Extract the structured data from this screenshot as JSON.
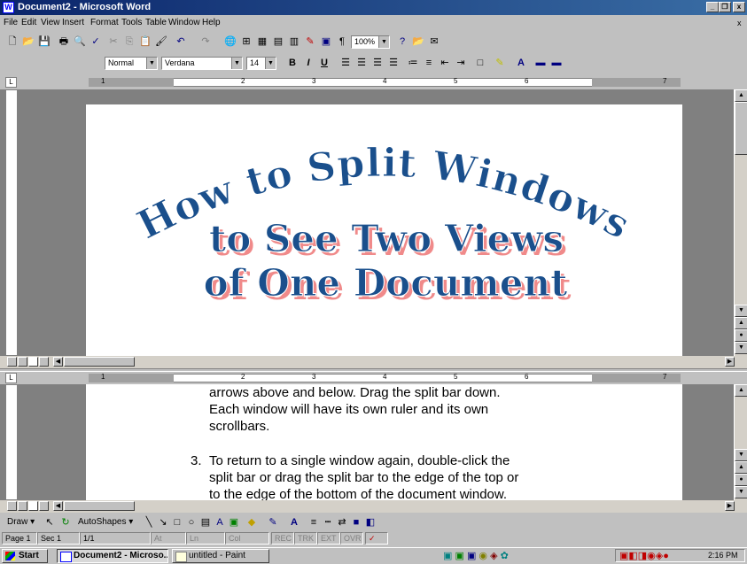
{
  "window": {
    "title": "Document2 - Microsoft Word",
    "minimize_label": "_",
    "restore_label": "❐",
    "close_label": "x"
  },
  "menu": [
    "File",
    "Edit",
    "View",
    "Insert",
    "Format",
    "Tools",
    "Table",
    "Window",
    "Help"
  ],
  "toolbar": {
    "zoom": "100%"
  },
  "formatting": {
    "style": "Normal",
    "font": "Verdana",
    "size": "14",
    "bold": "B",
    "italic": "I",
    "underline": "U"
  },
  "ruler": {
    "numbers": [
      "1",
      "2",
      "3",
      "4",
      "5",
      "6",
      "7"
    ]
  },
  "wordart": {
    "line1": "How to Split Windows",
    "line2": "to See Two Views",
    "line3": "of One Document"
  },
  "document": {
    "para2_cont": [
      "arrows above and below.  Drag the split bar down.",
      "Each window will have its own ruler and its own",
      "scrollbars."
    ],
    "step3_number": "3.",
    "step3_lines": [
      "To return to a single window again, double-click the",
      "split bar or drag the split bar to the edge of the top or",
      "to the edge of the bottom of the document window."
    ]
  },
  "drawing": {
    "draw_label": "Draw",
    "autoshapes_label": "AutoShapes"
  },
  "status": {
    "page": "Page 1",
    "sec": "Sec 1",
    "pages": "1/1",
    "at": "At",
    "ln": "Ln",
    "col": "Col",
    "rec": "REC",
    "trk": "TRK",
    "ext": "EXT",
    "ovr": "OVR"
  },
  "taskbar": {
    "start": "Start",
    "task1": "Document2 - Microso...",
    "task2": "untitled - Paint",
    "clock": "2:16 PM"
  },
  "colors": {
    "titlebar": "#0a246a",
    "wordart_fill": "#1a4f8c",
    "wordart_shadow": "#f08a8a"
  }
}
